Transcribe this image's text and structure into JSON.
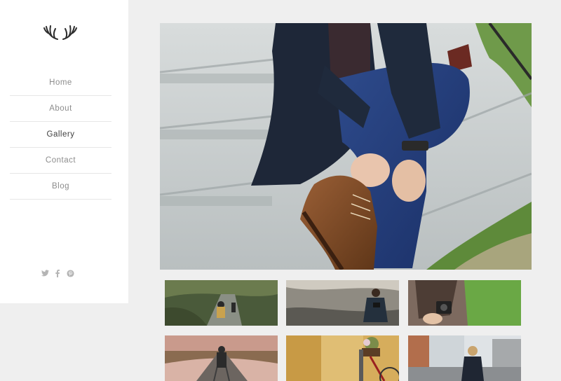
{
  "nav": {
    "items": [
      {
        "label": "Home"
      },
      {
        "label": "About"
      },
      {
        "label": "Gallery"
      },
      {
        "label": "Contact"
      },
      {
        "label": "Blog"
      }
    ],
    "active_index": 2
  },
  "social": {
    "icons": [
      "twitter-icon",
      "facebook-icon",
      "pinterest-icon"
    ]
  },
  "gallery": {
    "hero": {
      "alt": "Man tying brown boot on stone steps"
    },
    "thumbnails": [
      {
        "name": "hikers-on-bridge"
      },
      {
        "name": "man-with-camera-on-rocks"
      },
      {
        "name": "person-in-plaid-with-camera"
      },
      {
        "name": "photographer-on-railroad-tracks"
      },
      {
        "name": "bicycle-with-flower-basket"
      },
      {
        "name": "man-in-city-street"
      }
    ]
  },
  "colors": {
    "background": "#efefef",
    "sidebar": "#ffffff",
    "nav_text": "#8c8c8c",
    "nav_active": "#3d3d3d",
    "divider": "#e6e6e6"
  }
}
